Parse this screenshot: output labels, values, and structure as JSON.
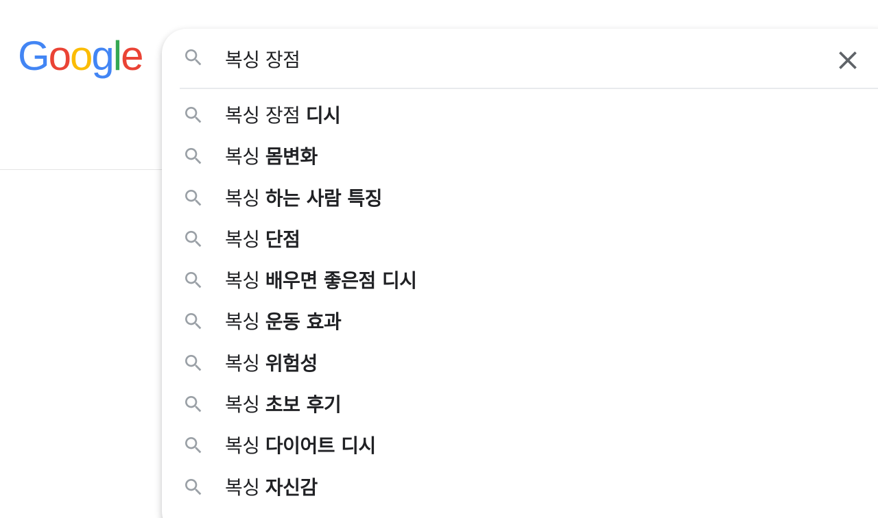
{
  "logo": {
    "letters": [
      "G",
      "o",
      "o",
      "g",
      "l",
      "e"
    ],
    "colors": [
      "#4285F4",
      "#EA4335",
      "#FBBC05",
      "#4285F4",
      "#34A853",
      "#EA4335"
    ]
  },
  "search": {
    "query": "복싱 장점",
    "search_icon": "search-icon",
    "clear_icon": "close-icon"
  },
  "suggestions": [
    {
      "prefix": "복싱 장점 ",
      "completion": "디시"
    },
    {
      "prefix": "복싱 ",
      "completion": "몸변화"
    },
    {
      "prefix": "복싱 ",
      "completion": "하는 사람 특징"
    },
    {
      "prefix": "복싱 ",
      "completion": "단점"
    },
    {
      "prefix": "복싱 ",
      "completion": "배우면 좋은점 디시"
    },
    {
      "prefix": "복싱 ",
      "completion": "운동 효과"
    },
    {
      "prefix": "복싱 ",
      "completion": "위험성"
    },
    {
      "prefix": "복싱 ",
      "completion": "초보 후기"
    },
    {
      "prefix": "복싱 ",
      "completion": "다이어트 디시"
    },
    {
      "prefix": "복싱 ",
      "completion": "자신감"
    }
  ],
  "colors": {
    "text": "#202124",
    "icon": "#9aa0a6",
    "clear": "#5f6368",
    "divider": "#e8eaed"
  }
}
